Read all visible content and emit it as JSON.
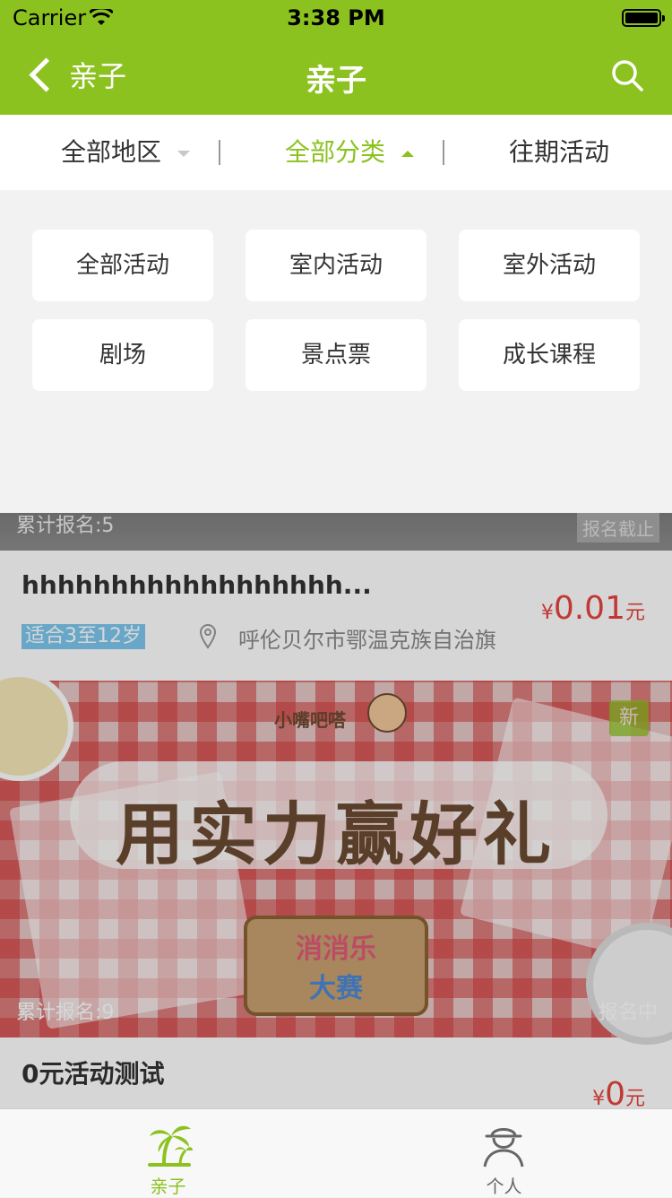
{
  "status": {
    "carrier": "Carrier",
    "time": "3:38 PM"
  },
  "nav": {
    "back_label": "亲子",
    "title": "亲子"
  },
  "filters": [
    {
      "label": "全部地区",
      "state": "collapsed"
    },
    {
      "label": "全部分类",
      "state": "expanded"
    },
    {
      "label": "往期活动"
    }
  ],
  "categories": [
    "全部活动",
    "室内活动",
    "室外活动",
    "剧场",
    "景点票",
    "成长课程"
  ],
  "cards": [
    {
      "signup_count": "累计报名:5",
      "status": "报名截止",
      "title": "hhhhhhhhhhhhhhhhhh...",
      "tag": "适合3至12岁",
      "address": "呼伦贝尔市鄂温克族自治旗",
      "price": {
        "currency": "¥",
        "value": "0.01",
        "unit": "元"
      }
    },
    {
      "banner_text": "用实力赢好礼",
      "banner_logo": "小嘴吧嗒",
      "game_title_1": "消消乐",
      "game_title_2": "大赛",
      "new_badge": "新",
      "signup_count": "累计报名:9",
      "status": "报名中",
      "title": "0元活动测试",
      "price": {
        "currency": "¥",
        "value": "0",
        "unit": "元"
      }
    }
  ],
  "tabbar": [
    {
      "label": "亲子",
      "icon": "palm-tree-icon",
      "active": true
    },
    {
      "label": "个人",
      "icon": "person-icon",
      "active": false
    }
  ],
  "colors": {
    "brand": "#8cc21f",
    "price": "#e8443e",
    "tag": "#7ec7ef"
  }
}
